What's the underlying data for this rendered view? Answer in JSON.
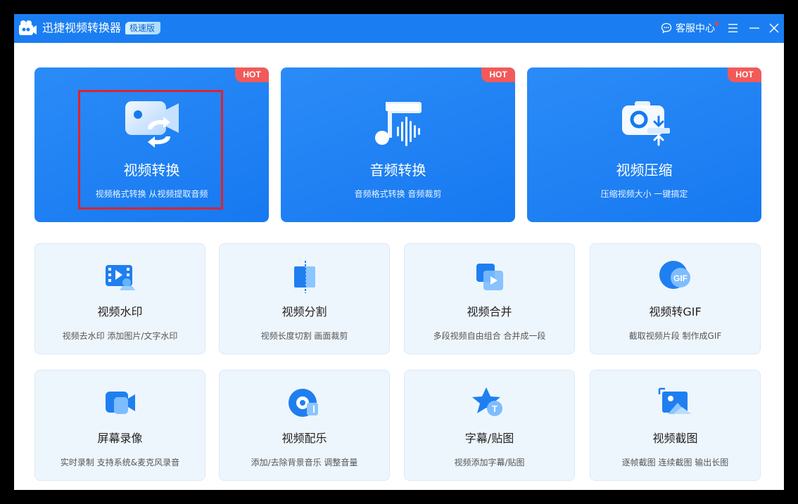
{
  "app": {
    "title": "迅捷视频转换器",
    "edition": "极速版",
    "support_label": "客服中心"
  },
  "colors": {
    "titlebar": "#1a7ef2",
    "big_card": "#1679f0",
    "hot_tag": "#f25a5a",
    "small_card_bg": "#eef6fd",
    "highlight": "#e0232b"
  },
  "window_controls": [
    "menu-icon",
    "minimize-icon",
    "close-icon"
  ],
  "big_cards": [
    {
      "title": "视频转换",
      "subtitle": "视频格式转换 从视频提取音频",
      "badge": "HOT",
      "icon": "video-convert-icon",
      "highlighted": true
    },
    {
      "title": "音频转换",
      "subtitle": "音频格式转换 音频裁剪",
      "badge": "HOT",
      "icon": "audio-convert-icon",
      "highlighted": false
    },
    {
      "title": "视频压缩",
      "subtitle": "压缩视频大小 一键搞定",
      "badge": "HOT",
      "icon": "video-compress-icon",
      "highlighted": false
    }
  ],
  "small_cards": [
    {
      "title": "视频水印",
      "subtitle": "视频去水印 添加图片/文字水印",
      "icon": "video-watermark-icon"
    },
    {
      "title": "视频分割",
      "subtitle": "视频长度切割 画面裁剪",
      "icon": "video-split-icon"
    },
    {
      "title": "视频合并",
      "subtitle": "多段视频自由组合 合并成一段",
      "icon": "video-merge-icon"
    },
    {
      "title": "视频转GIF",
      "subtitle": "截取视频片段 制作成GIF",
      "icon": "video-to-gif-icon",
      "icon_text": "GIF"
    },
    {
      "title": "屏幕录像",
      "subtitle": "实时录制 支持系统&麦克风录音",
      "icon": "screen-record-icon"
    },
    {
      "title": "视频配乐",
      "subtitle": "添加/去除背景音乐 调整音量",
      "icon": "video-music-icon"
    },
    {
      "title": "字幕/贴图",
      "subtitle": "视频添加字幕/贴图",
      "icon": "subtitle-sticker-icon",
      "icon_text": "T"
    },
    {
      "title": "视频截图",
      "subtitle": "逐帧截图 连续截图 输出长图",
      "icon": "video-screenshot-icon"
    }
  ]
}
